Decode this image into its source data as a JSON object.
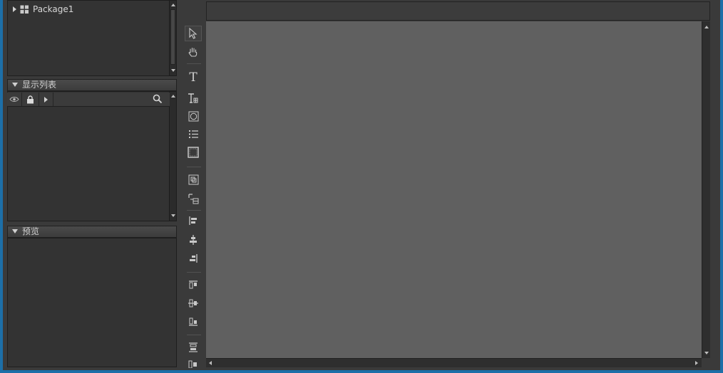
{
  "library": {
    "items": [
      {
        "label": "Package1",
        "icon": "package-icon",
        "expanded": false
      }
    ]
  },
  "display_list": {
    "title": "显示列表",
    "toolbar": {
      "visibility_icon": "eye-icon",
      "lock_icon": "lock-icon",
      "expand_icon": "triangle-right-icon",
      "search_icon": "search-icon"
    }
  },
  "preview": {
    "title": "预览"
  },
  "tools": [
    {
      "name": "select-tool",
      "icon": "arrow-cursor-icon",
      "selected": true
    },
    {
      "name": "hand-tool",
      "icon": "hand-icon",
      "selected": false
    },
    {
      "name": "text-tool",
      "icon": "text-icon",
      "glyph": "T",
      "selected": false
    },
    {
      "name": "rich-text-tool",
      "icon": "rich-text-icon",
      "selected": false
    },
    {
      "name": "shape-tool",
      "icon": "shape-icon",
      "selected": false
    },
    {
      "name": "list-tool",
      "icon": "list-icon",
      "selected": false
    },
    {
      "name": "frame-tool",
      "icon": "frame-icon",
      "selected": false
    },
    {
      "name": "group-tool",
      "icon": "group-icon",
      "selected": false
    },
    {
      "name": "relation-tool",
      "icon": "relation-icon",
      "selected": false
    },
    {
      "name": "align-left-tool",
      "icon": "align-left-icon",
      "selected": false
    },
    {
      "name": "align-center-h-tool",
      "icon": "align-center-h-icon",
      "selected": false
    },
    {
      "name": "align-right-tool",
      "icon": "align-right-icon",
      "selected": false
    },
    {
      "name": "align-top-tool",
      "icon": "align-top-icon",
      "selected": false
    },
    {
      "name": "align-middle-v-tool",
      "icon": "align-middle-v-icon",
      "selected": false
    },
    {
      "name": "align-bottom-tool",
      "icon": "align-bottom-icon",
      "selected": false
    },
    {
      "name": "distribute-h-tool",
      "icon": "distribute-h-icon",
      "selected": false
    },
    {
      "name": "distribute-v-tool",
      "icon": "distribute-v-icon",
      "selected": false
    }
  ],
  "colors": {
    "accent_frame": "#1d6fa8",
    "canvas": "#606060",
    "panel": "#333333"
  }
}
